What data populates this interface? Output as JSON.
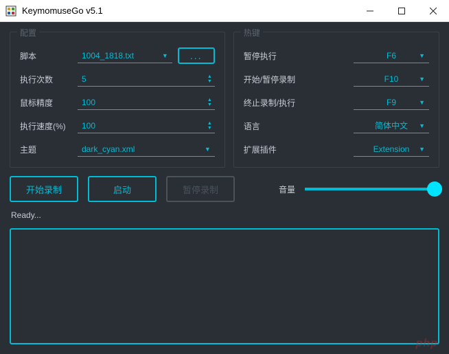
{
  "window": {
    "title": "KeymomuseGo v5.1"
  },
  "config": {
    "group_title": "配置",
    "script_label": "脚本",
    "script_value": "1004_1818.txt",
    "browse_label": "...",
    "count_label": "执行次数",
    "count_value": "5",
    "precision_label": "鼠标精度",
    "precision_value": "100",
    "speed_label": "执行速度(%)",
    "speed_value": "100",
    "theme_label": "主题",
    "theme_value": "dark_cyan.xml"
  },
  "hotkey": {
    "group_title": "热键",
    "pause_label": "暂停执行",
    "pause_value": "F6",
    "record_label": "开始/暂停录制",
    "record_value": "F10",
    "stop_label": "终止录制/执行",
    "stop_value": "F9",
    "lang_label": "语言",
    "lang_value": "简体中文",
    "ext_label": "扩展插件",
    "ext_value": "Extension"
  },
  "actions": {
    "start_record": "开始录制",
    "launch": "启动",
    "pause_record": "暂停录制",
    "volume_label": "音量",
    "volume_value": 100
  },
  "status": {
    "text": "Ready..."
  },
  "watermark": "php"
}
